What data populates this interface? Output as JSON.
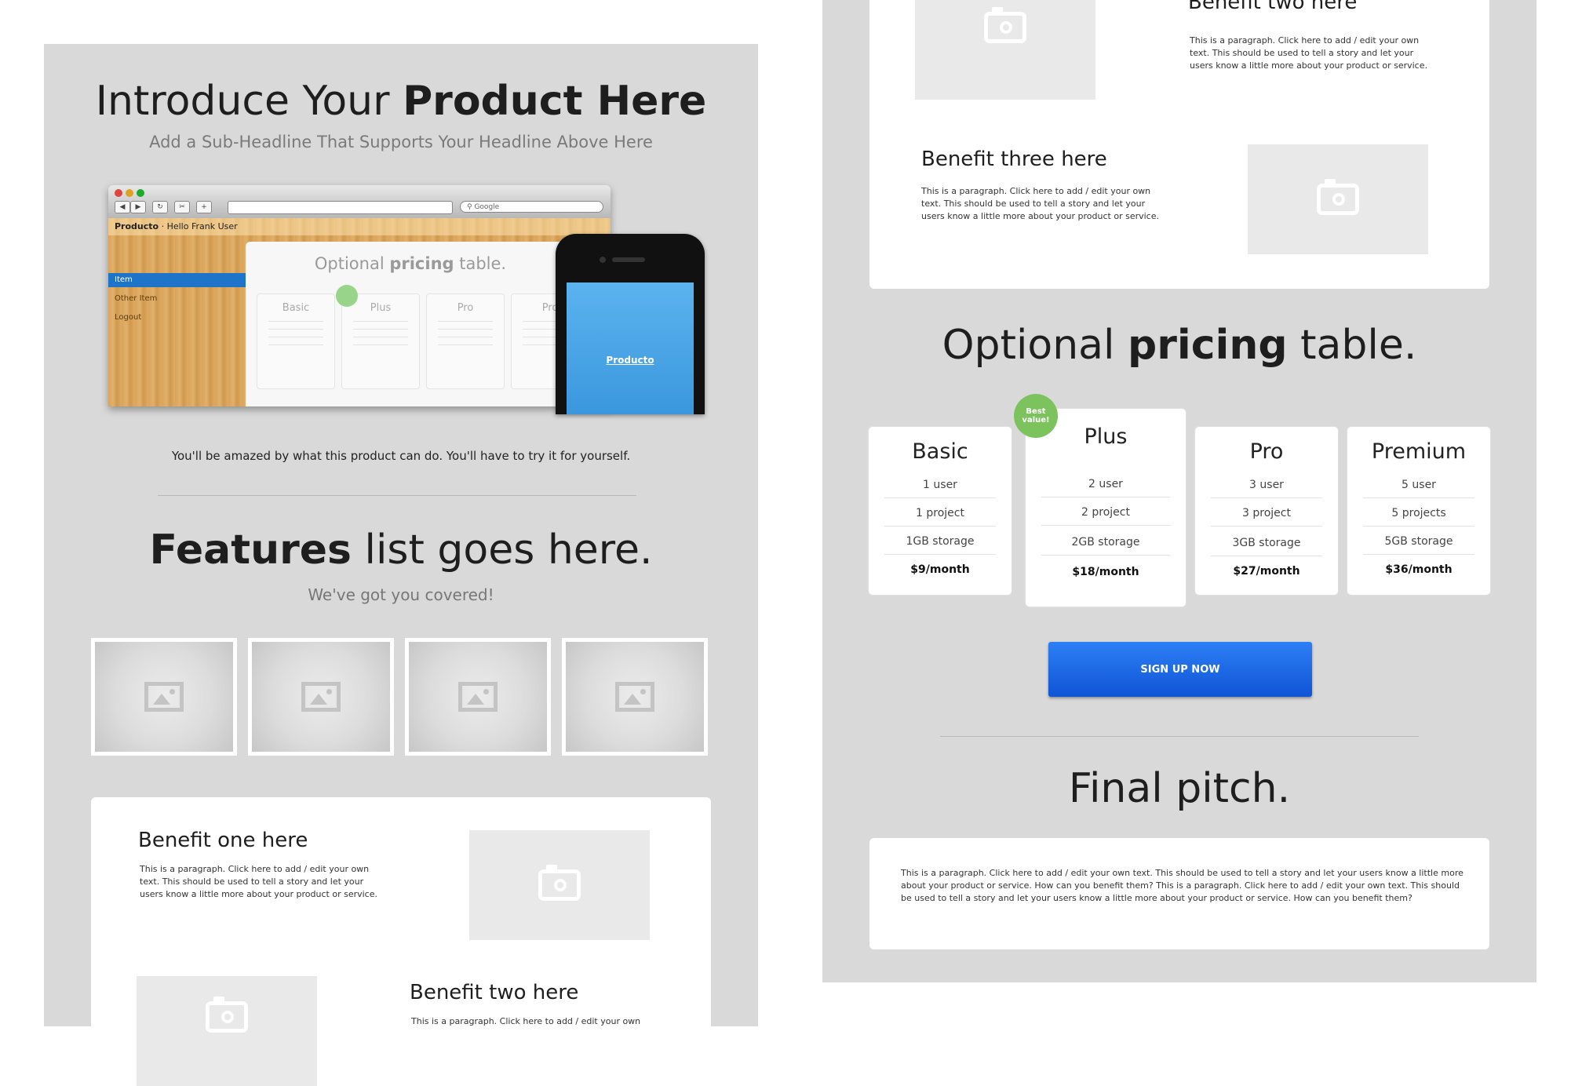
{
  "hero": {
    "title_light": "Introduce Your ",
    "title_bold": "Product Here",
    "subtitle": "Add a Sub-Headline That Supports Your Headline Above Here",
    "tagline": "You'll be amazed by what this product can do. You'll have to try it for yourself."
  },
  "mockup": {
    "search_placeholder": "Google",
    "app_brand": "Producto",
    "app_greeting": "· Hello Frank User",
    "sidebar": [
      "Item",
      "Other Item",
      "Logout"
    ],
    "mini_title_a": "Optional ",
    "mini_title_b": "pricing",
    "mini_title_c": " table.",
    "mini_plans": [
      "Basic",
      "Plus",
      "Pro",
      "Pro"
    ],
    "phone_label": "Producto"
  },
  "features": {
    "title_bold": "Features",
    "title_light": " list goes here.",
    "subtitle": "We've got you covered!"
  },
  "benefits": {
    "one": {
      "title": "Benefit one here",
      "text": "This is a paragraph. Click here to add / edit your own text. This should be used to tell a story and let your users know a little more about your product or service."
    },
    "two": {
      "title": "Benefit two here",
      "text": "This is a paragraph. Click here to add / edit your own text. This should be used to tell a story and let your users know a little more about your product or service."
    },
    "two_left_title": "Benefit two here",
    "two_left_text": "This is a paragraph. Click here to add / edit your own",
    "three": {
      "title": "Benefit three here",
      "text": "This is a paragraph. Click here to add / edit your own text. This should be used to tell a story and let your users know a little more about your product or service."
    }
  },
  "pricing": {
    "title_a": "Optional ",
    "title_b": "pricing",
    "title_c": " table.",
    "badge": "Best value!",
    "plans": [
      {
        "name": "Basic",
        "users": "1 user",
        "projects": "1 project",
        "storage": "1GB storage",
        "price": "$9/month"
      },
      {
        "name": "Plus",
        "users": "2 user",
        "projects": "2 project",
        "storage": "2GB storage",
        "price": "$18/month"
      },
      {
        "name": "Pro",
        "users": "3 user",
        "projects": "3 project",
        "storage": "3GB storage",
        "price": "$27/month"
      },
      {
        "name": "Premium",
        "users": "5 user",
        "projects": "5 projects",
        "storage": "5GB storage",
        "price": "$36/month"
      }
    ],
    "cta": "SIGN UP NOW"
  },
  "final": {
    "title": "Final pitch.",
    "text": "This is a paragraph. Click here to add / edit your own text. This should be used to tell a story and let your users know a little more about your product or service. How can you benefit them? This is a paragraph. Click here to add / edit your own text. This should be used to tell a story and let your users know a little more about your product or service. How can you benefit them?"
  },
  "colors": {
    "panel_bg": "#d9d9d9",
    "cta_blue": "#1a66e8",
    "badge_green": "#7cc35d"
  }
}
